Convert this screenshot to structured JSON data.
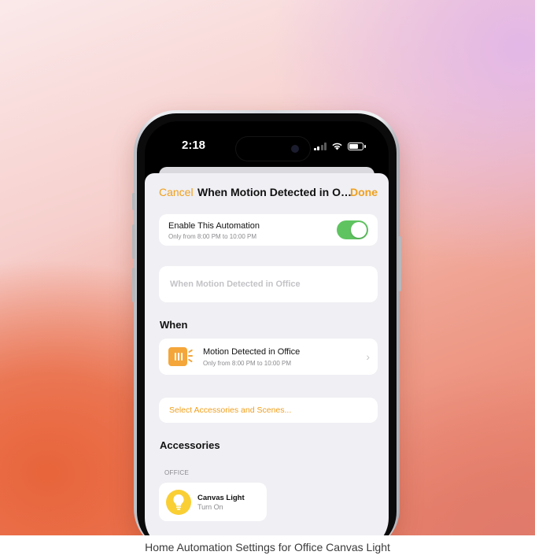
{
  "status_bar": {
    "time": "2:18"
  },
  "nav": {
    "cancel": "Cancel",
    "title": "When Motion Detected in Office",
    "done": "Done"
  },
  "enable": {
    "title": "Enable This Automation",
    "subtitle": "Only from 8:00 PM to 10:00 PM",
    "toggle_on": true
  },
  "name_field": {
    "placeholder": "When Motion Detected in Office",
    "value": ""
  },
  "when": {
    "section_title": "When",
    "trigger_title": "Motion Detected in Office",
    "trigger_subtitle": "Only from 8:00 PM to 10:00 PM",
    "icon": "motion-sensor-icon"
  },
  "select_link": "Select Accessories and Scenes...",
  "accessories": {
    "section_title": "Accessories",
    "room_label": "OFFICE",
    "items": [
      {
        "name": "Canvas Light",
        "action": "Turn On",
        "icon": "lightbulb-icon"
      }
    ]
  },
  "caption": "Home Automation Settings for Office Canvas Light",
  "colors": {
    "accent": "#f0a01d",
    "toggle_on": "#5fc460",
    "sensor_icon_bg": "#f4a63a",
    "bulb_bg": "#f9cf34",
    "sheet_bg": "#efeff4"
  }
}
